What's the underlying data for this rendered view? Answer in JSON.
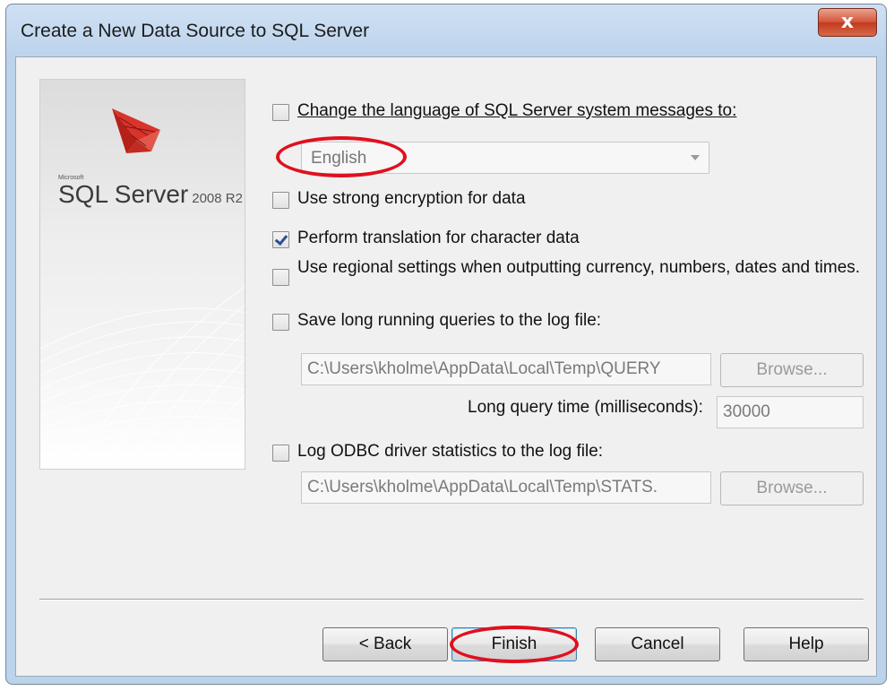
{
  "window": {
    "title": "Create a New Data Source to SQL Server",
    "close_symbol": "x"
  },
  "brand": {
    "microsoft": "Microsoft",
    "product": "SQL Server",
    "version": "2008 R2",
    "logo_icon": "sql-server-logo-icon"
  },
  "options": {
    "change_language": {
      "label": "Change the language of SQL Server system messages to:",
      "checked": false
    },
    "language": {
      "value": "English"
    },
    "strong_encryption": {
      "label": "Use strong encryption for data",
      "checked": false
    },
    "translation": {
      "label": "Perform translation for character data",
      "checked": true
    },
    "regional_settings": {
      "label": "Use regional settings when outputting currency, numbers, dates and times.",
      "checked": false
    },
    "save_long_queries": {
      "label": "Save long running queries to the log file:",
      "checked": false
    },
    "query_log_path": "C:\\Users\\kholme\\AppData\\Local\\Temp\\QUERY",
    "long_query_time_label": "Long query time (milliseconds):",
    "long_query_time_value": "30000",
    "log_odbc_stats": {
      "label": "Log ODBC driver statistics to the log file:",
      "checked": false
    },
    "stats_log_path": "C:\\Users\\kholme\\AppData\\Local\\Temp\\STATS.",
    "browse_label": "Browse..."
  },
  "buttons": {
    "back": "< Back",
    "finish": "Finish",
    "cancel": "Cancel",
    "help": "Help"
  },
  "colors": {
    "annotation": "#e0101e"
  }
}
